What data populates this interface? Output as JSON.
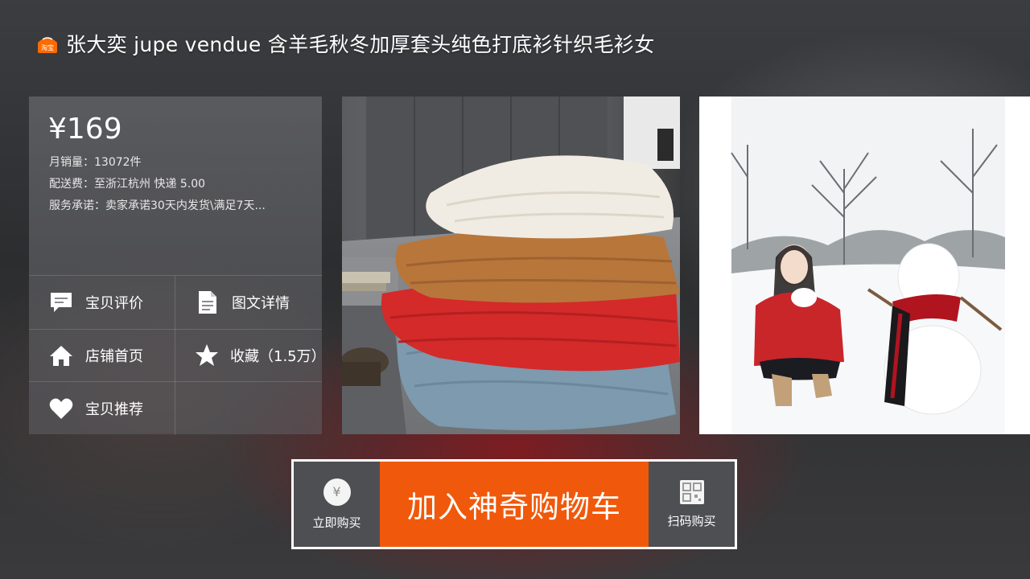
{
  "header": {
    "logo_text": "淘宝",
    "title": "张大奕 jupe vendue 含羊毛秋冬加厚套头纯色打底衫针织毛衫女"
  },
  "product": {
    "price": "¥169",
    "monthly_sales": "月销量：13072件",
    "shipping": "配送费：至浙江杭州 快递 5.00",
    "service": "服务承诺：卖家承诺30天内发货\\满足7天..."
  },
  "actions": {
    "reviews": {
      "label": "宝贝评价",
      "icon": "comment-icon"
    },
    "details": {
      "label": "图文详情",
      "icon": "document-icon"
    },
    "store": {
      "label": "店铺首页",
      "icon": "home-icon"
    },
    "favorite": {
      "label": "收藏（1.5万）",
      "icon": "star-icon"
    },
    "recommend": {
      "label": "宝贝推荐",
      "icon": "heart-icon"
    }
  },
  "images": {
    "image1": {
      "subject": "stack of knit sweaters"
    },
    "image2": {
      "subject": "woman in red sweater beside snowman"
    }
  },
  "buy_bar": {
    "buy_now": {
      "label": "立即购买",
      "icon_glyph": "¥",
      "icon": "yuan-icon"
    },
    "add_to_cart": {
      "label": "加入神奇购物车"
    },
    "scan_buy": {
      "label": "扫码购买",
      "icon": "qr-code-icon"
    }
  },
  "colors": {
    "accent": "#f0590b",
    "taobao": "#ff6a00"
  }
}
